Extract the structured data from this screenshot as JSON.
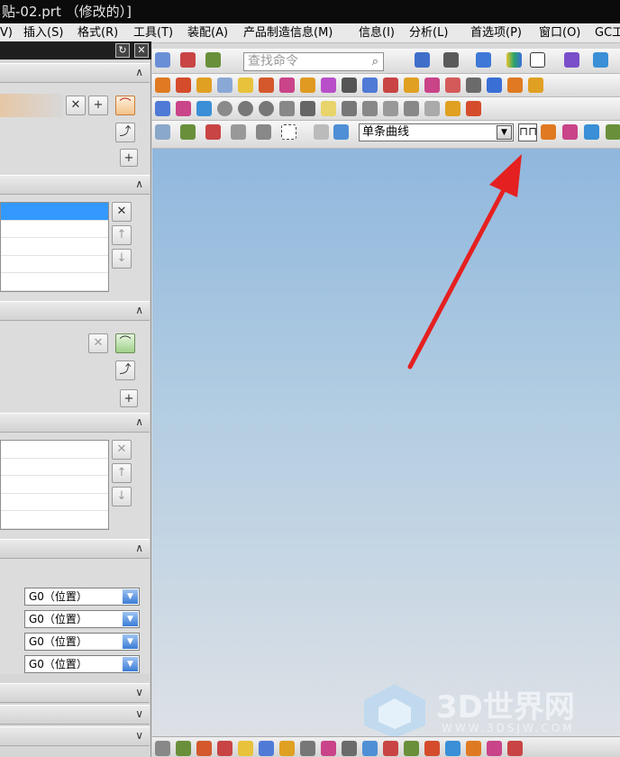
{
  "window": {
    "title": "贴-02.prt （修改的）]"
  },
  "menubar": {
    "items": [
      "V)",
      "插入(S)",
      "格式(R)",
      "工具(T)",
      "装配(A)",
      "产品制造信息(M)",
      "信息(I)",
      "分析(L)",
      "首选项(P)",
      "窗口(O)",
      "GC工"
    ]
  },
  "panel": {
    "refresh_icon": "↻",
    "close_icon": "✕",
    "collapse_glyph": "∧",
    "expand_glyph": "∨",
    "combos": [
      "G0（位置）",
      "G0（位置）",
      "G0（位置）",
      "G0（位置）"
    ]
  },
  "toolbar": {
    "search_placeholder": "查找命令",
    "selection_filter": "单条曲线",
    "highlighted_button_label": "⊓⊓"
  },
  "watermark": {
    "text": "3D世界网",
    "url": "WWW.3DSJW.COM"
  },
  "colors": {
    "viewport_top": "#8fb7dd",
    "viewport_bottom": "#dde1e6",
    "arrow": "#e52020",
    "selected_row": "#3399ff"
  }
}
